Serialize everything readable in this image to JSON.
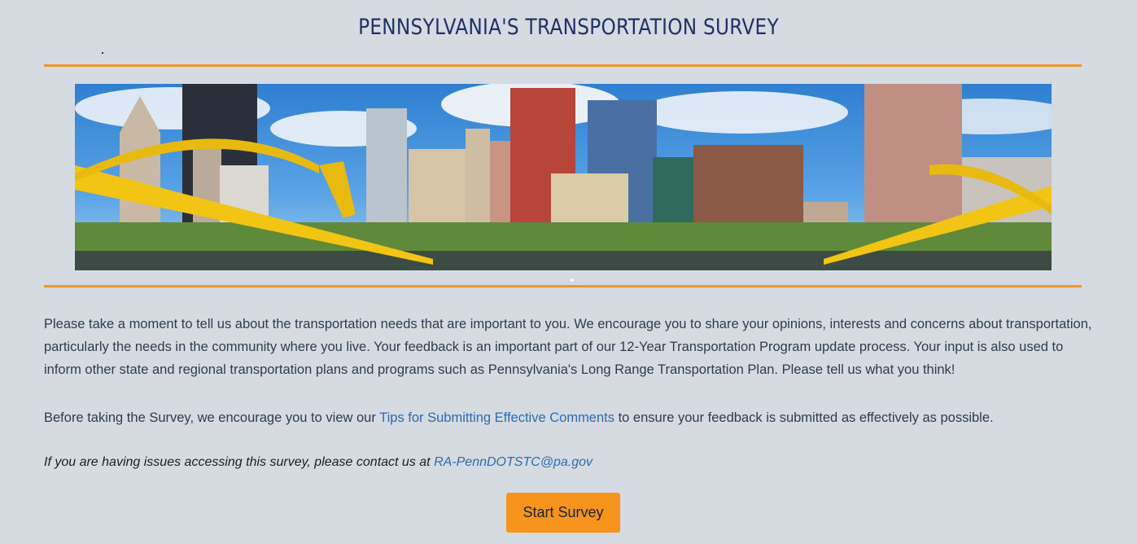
{
  "header": {
    "title": "PENNSYLVANIA'S TRANSPORTATION SURVEY"
  },
  "colors": {
    "accent": "#f0932b",
    "title": "#1f3265",
    "link": "#2b6cb0",
    "button": "#f7941d",
    "background": "#d5dbe0"
  },
  "banner": {
    "icon": "pittsburgh-skyline-image"
  },
  "intro": {
    "paragraph": "Please take a moment to tell us about the transportation needs that are important to you. We encourage you to share your opinions, interests and concerns about transportation, particularly the needs in the community where you live. Your feedback is an important part of our 12-Year Transportation Program update process. Your input is also used to inform other state and regional transportation plans and programs such as Pennsylvania's Long Range Transportation Plan. Please tell us what you think!"
  },
  "tips": {
    "before": "Before taking the Survey, we encourage you to view our ",
    "link_text": "Tips for Submitting Effective Comments",
    "after": " to ensure your feedback is submitted as effectively as possible."
  },
  "contact": {
    "text": "If you are having issues accessing this survey, please contact us at ",
    "email": "RA-PennDOTSTC@pa.gov"
  },
  "actions": {
    "start_label": "Start Survey"
  }
}
